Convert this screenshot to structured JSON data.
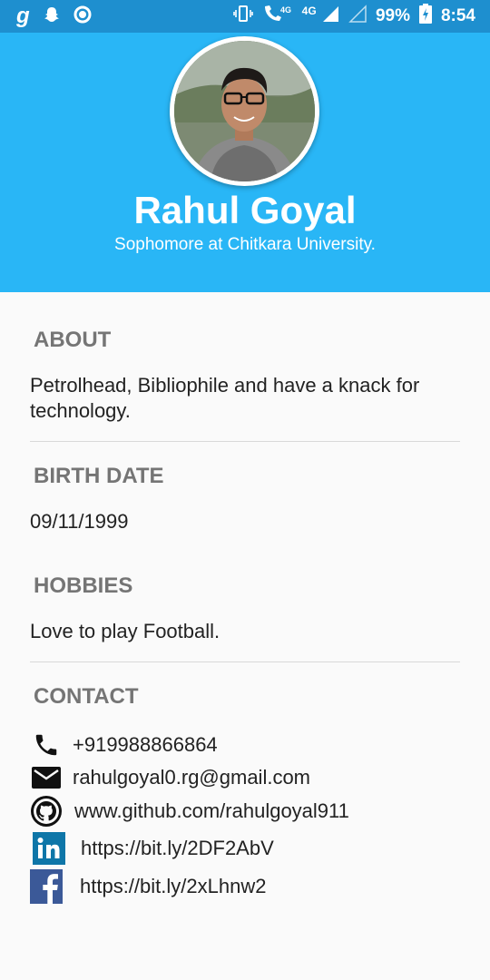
{
  "status_bar": {
    "battery": "99%",
    "time": "8:54",
    "network": "4G",
    "volte": "4G"
  },
  "profile": {
    "name": "Rahul Goyal",
    "subtitle": "Sophomore at Chitkara University."
  },
  "sections": {
    "about": {
      "title": "ABOUT",
      "text": "Petrolhead, Bibliophile and have a knack for technology."
    },
    "birth_date": {
      "title": "BIRTH DATE",
      "text": "09/11/1999"
    },
    "hobbies": {
      "title": "HOBBIES",
      "text": "Love to play Football."
    },
    "contact": {
      "title": "CONTACT"
    }
  },
  "contacts": [
    {
      "icon": "phone-icon",
      "text": "+919988866864"
    },
    {
      "icon": "email-icon",
      "text": "rahulgoyal0.rg@gmail.com"
    },
    {
      "icon": "github-icon",
      "text": "www.github.com/rahulgoyal911"
    },
    {
      "icon": "linkedin-icon",
      "text": "https://bit.ly/2DF2AbV"
    },
    {
      "icon": "facebook-icon",
      "text": "https://bit.ly/2xLhnw2"
    }
  ],
  "colors": {
    "status_bar": "#1e8fcf",
    "header": "#29b6f6",
    "section_title": "#757575",
    "linkedin": "#0e76a8",
    "facebook": "#3b5998"
  }
}
